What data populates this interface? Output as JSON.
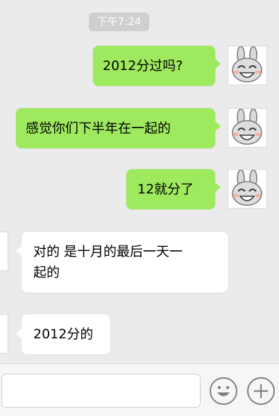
{
  "chat": {
    "timestamp": "下午7:24",
    "messages": [
      {
        "sender": "me",
        "text": "2012分过吗?"
      },
      {
        "sender": "me",
        "text": "感觉你们下半年在一起的"
      },
      {
        "sender": "me",
        "text": "12就分了"
      },
      {
        "sender": "other",
        "lines": [
          "对的 是十月的最后一天一",
          "起的"
        ]
      },
      {
        "sender": "other",
        "text": "2012分的"
      }
    ]
  },
  "input_bar": {
    "message_value": "",
    "emoji_icon": "smiley-face-icon",
    "more_icon": "plus-circle-icon"
  },
  "colors": {
    "my_bubble": "#9fe95f",
    "other_bubble": "#ffffff",
    "background": "#ebebeb"
  }
}
